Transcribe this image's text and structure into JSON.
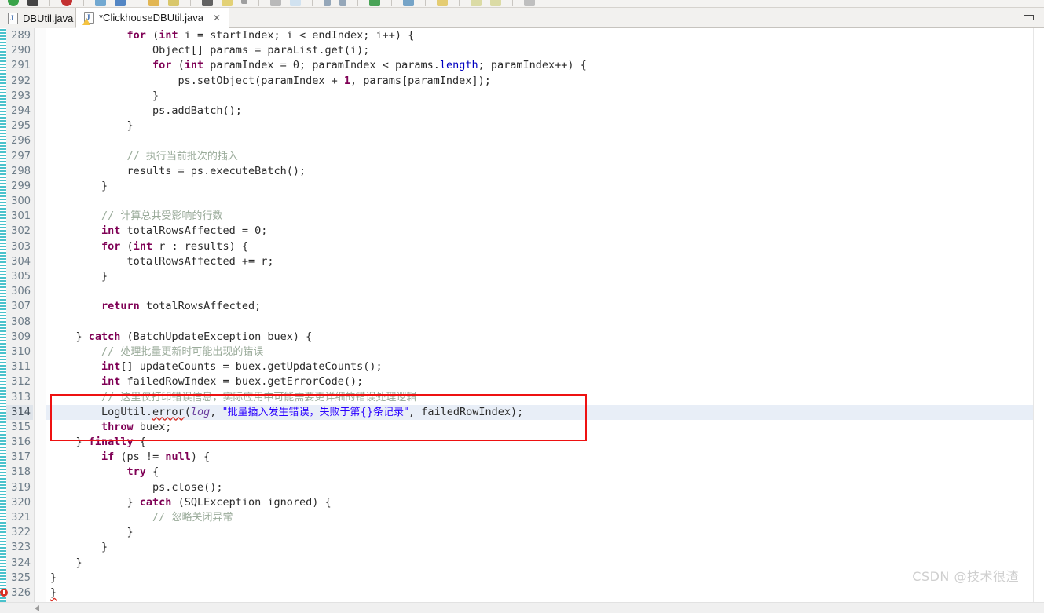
{
  "window": {
    "restore_button": "restore-window"
  },
  "toolbar": {
    "icons": [
      "run-icon",
      "debug-icon",
      "stop-icon",
      "coverage-icon",
      "external-tools-icon",
      "search-icon",
      "new-folder-icon",
      "save-icon",
      "save-all-icon",
      "print-icon",
      "undo-icon",
      "redo-icon",
      "back-icon",
      "forward-icon",
      "next-annotation-icon",
      "previous-annotation-icon",
      "last-edit-icon",
      "bookmark-icon",
      "task-icon",
      "perspective-icon",
      "terminal-icon"
    ]
  },
  "tabs": [
    {
      "label": "DBUtil.java",
      "active": false,
      "dirty": false,
      "has_warning": false
    },
    {
      "label": "*ClickhouseDBUtil.java",
      "active": true,
      "dirty": true,
      "has_warning": true,
      "close_glyph": "✕"
    }
  ],
  "editor": {
    "first_line": 289,
    "current_line": 314,
    "error_line": 326,
    "highlight_color": "#e8eef7",
    "annotation_box_color": "#ee1111",
    "lines": [
      {
        "n": 289,
        "text": "            for (int i = startIndex; i < endIndex; i++) {"
      },
      {
        "n": 290,
        "text": "                Object[] params = paraList.get(i);"
      },
      {
        "n": 291,
        "text": "                for (int paramIndex = 0; paramIndex < params.length; paramIndex++) {"
      },
      {
        "n": 292,
        "text": "                    ps.setObject(paramIndex + 1, params[paramIndex]);"
      },
      {
        "n": 293,
        "text": "                }"
      },
      {
        "n": 294,
        "text": "                ps.addBatch();"
      },
      {
        "n": 295,
        "text": "            }"
      },
      {
        "n": 296,
        "text": ""
      },
      {
        "n": 297,
        "text": "            // 执行当前批次的插入"
      },
      {
        "n": 298,
        "text": "            results = ps.executeBatch();"
      },
      {
        "n": 299,
        "text": "        }"
      },
      {
        "n": 300,
        "text": ""
      },
      {
        "n": 301,
        "text": "        // 计算总共受影响的行数"
      },
      {
        "n": 302,
        "text": "        int totalRowsAffected = 0;"
      },
      {
        "n": 303,
        "text": "        for (int r : results) {"
      },
      {
        "n": 304,
        "text": "            totalRowsAffected += r;"
      },
      {
        "n": 305,
        "text": "        }"
      },
      {
        "n": 306,
        "text": ""
      },
      {
        "n": 307,
        "text": "        return totalRowsAffected;"
      },
      {
        "n": 308,
        "text": ""
      },
      {
        "n": 309,
        "text": "    } catch (BatchUpdateException buex) {"
      },
      {
        "n": 310,
        "text": "        // 处理批量更新时可能出现的错误"
      },
      {
        "n": 311,
        "text": "        int[] updateCounts = buex.getUpdateCounts();"
      },
      {
        "n": 312,
        "text": "        int failedRowIndex = buex.getErrorCode();"
      },
      {
        "n": 313,
        "text": "        // 这里仅打印错误信息，实际应用中可能需要更详细的错误处理逻辑"
      },
      {
        "n": 314,
        "text": "        LogUtil.error(log, \"批量插入发生错误，失败于第{}条记录\", failedRowIndex);"
      },
      {
        "n": 315,
        "text": "        throw buex;"
      },
      {
        "n": 316,
        "text": "    } finally {"
      },
      {
        "n": 317,
        "text": "        if (ps != null) {"
      },
      {
        "n": 318,
        "text": "            try {"
      },
      {
        "n": 319,
        "text": "                ps.close();"
      },
      {
        "n": 320,
        "text": "            } catch (SQLException ignored) {"
      },
      {
        "n": 321,
        "text": "                // 忽略关闭异常"
      },
      {
        "n": 322,
        "text": "            }"
      },
      {
        "n": 323,
        "text": "        }"
      },
      {
        "n": 324,
        "text": "    }"
      },
      {
        "n": 325,
        "text": "}"
      },
      {
        "n": 326,
        "text": "}"
      }
    ]
  },
  "watermark": {
    "text": "CSDN @技术很渣"
  }
}
